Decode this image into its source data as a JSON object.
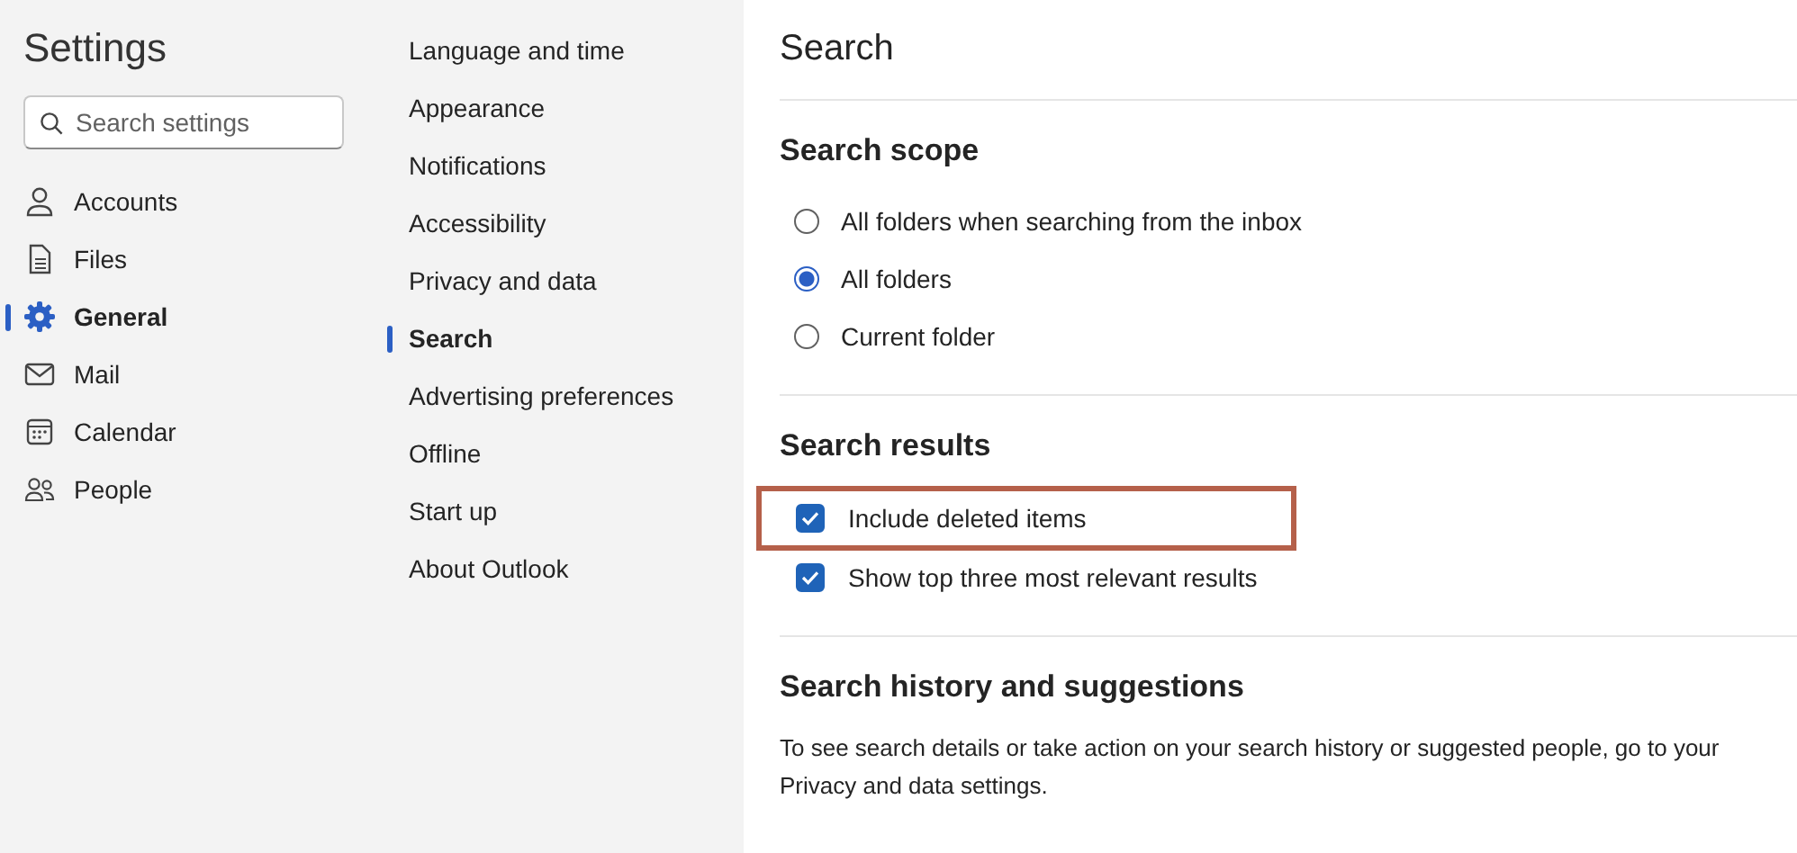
{
  "title": "Settings",
  "search": {
    "placeholder": "Search settings"
  },
  "nav": [
    {
      "label": "Accounts",
      "selected": false
    },
    {
      "label": "Files",
      "selected": false
    },
    {
      "label": "General",
      "selected": true
    },
    {
      "label": "Mail",
      "selected": false
    },
    {
      "label": "Calendar",
      "selected": false
    },
    {
      "label": "People",
      "selected": false
    }
  ],
  "subnav": [
    {
      "label": "Language and time",
      "selected": false
    },
    {
      "label": "Appearance",
      "selected": false
    },
    {
      "label": "Notifications",
      "selected": false
    },
    {
      "label": "Accessibility",
      "selected": false
    },
    {
      "label": "Privacy and data",
      "selected": false
    },
    {
      "label": "Search",
      "selected": true
    },
    {
      "label": "Advertising preferences",
      "selected": false
    },
    {
      "label": "Offline",
      "selected": false
    },
    {
      "label": "Start up",
      "selected": false
    },
    {
      "label": "About Outlook",
      "selected": false
    }
  ],
  "page_title": "Search",
  "scope": {
    "heading": "Search scope",
    "options": [
      {
        "label": "All folders when searching from the inbox",
        "selected": false
      },
      {
        "label": "All folders",
        "selected": true
      },
      {
        "label": "Current folder",
        "selected": false
      }
    ]
  },
  "results": {
    "heading": "Search results",
    "options": [
      {
        "label": "Include deleted items",
        "checked": true,
        "highlighted": true
      },
      {
        "label": "Show top three most relevant results",
        "checked": true,
        "highlighted": false
      }
    ]
  },
  "history": {
    "heading": "Search history and suggestions",
    "text": "To see search details or take action on your search history or suggested people, go to your Privacy and data settings."
  }
}
